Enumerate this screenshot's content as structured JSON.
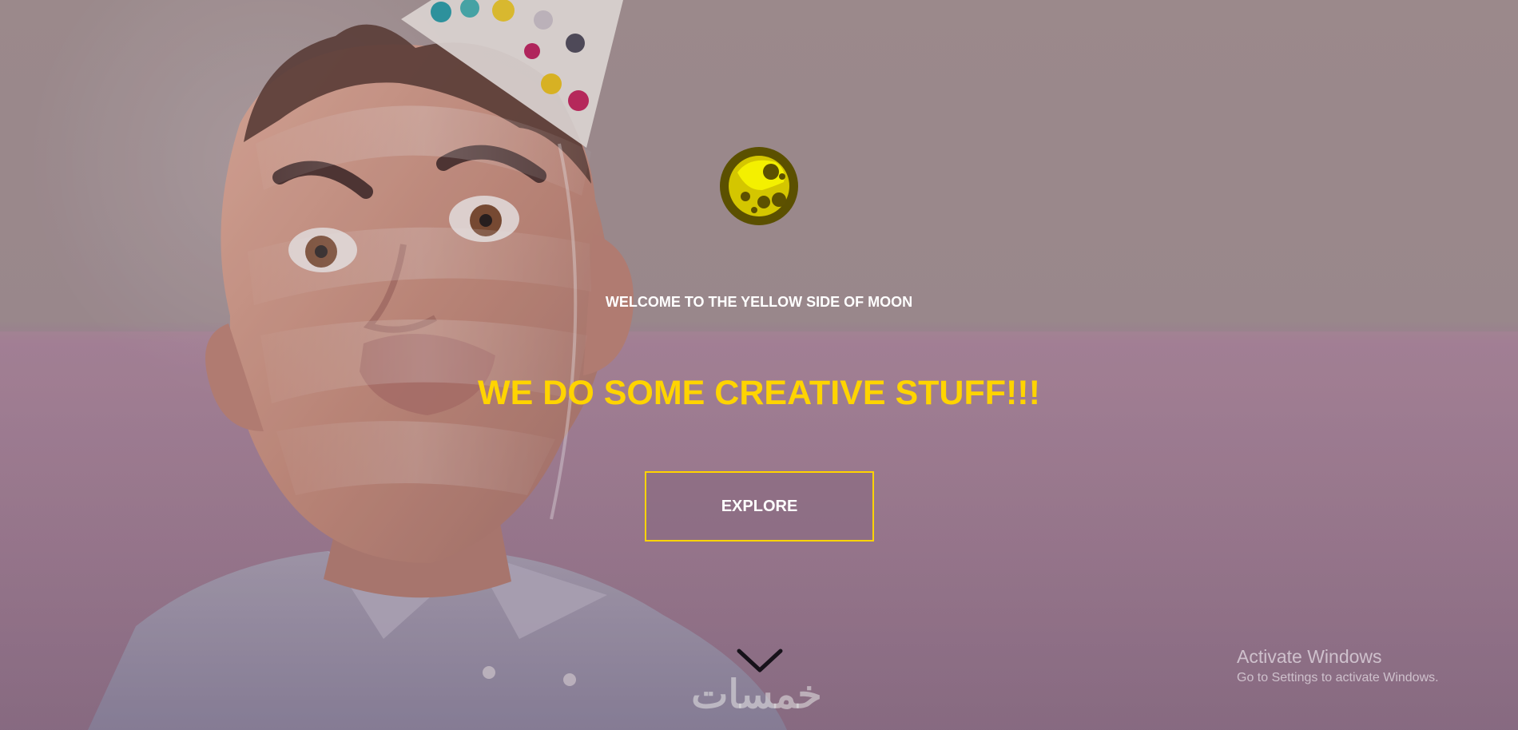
{
  "hero": {
    "welcome": "WELCOME TO THE YELLOW SIDE OF MOON",
    "headline": "WE DO SOME CREATIVE STUFF!!!",
    "explore_label": "EXPLORE",
    "accent_color": "#ffd400",
    "scroll_icon": "chevron-down-icon"
  },
  "watermark": {
    "text": "خمسات"
  },
  "system_notice": {
    "title": "Activate Windows",
    "subtitle": "Go to Settings to activate Windows."
  },
  "icons": {
    "logo": "yellow-moon-logo-icon",
    "scroll": "chevron-down-icon"
  }
}
